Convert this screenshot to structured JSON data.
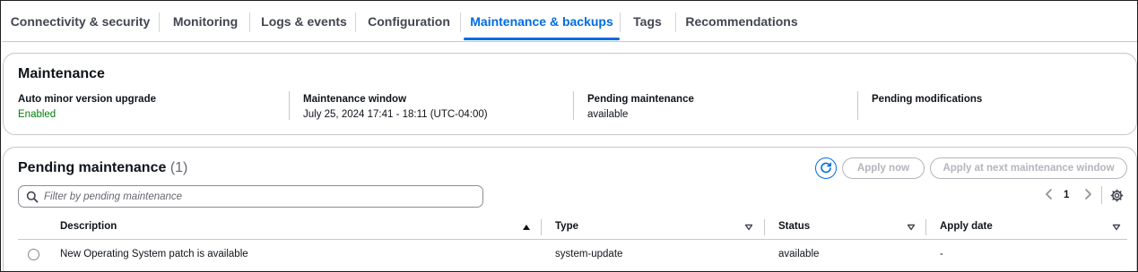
{
  "tabs": [
    {
      "label": "Connectivity & security"
    },
    {
      "label": "Monitoring"
    },
    {
      "label": "Logs & events"
    },
    {
      "label": "Configuration"
    },
    {
      "label": "Maintenance & backups"
    },
    {
      "label": "Tags"
    },
    {
      "label": "Recommendations"
    }
  ],
  "active_tab": "Maintenance & backups",
  "maintenance": {
    "title": "Maintenance",
    "auto_minor": {
      "label": "Auto minor version upgrade",
      "value": "Enabled"
    },
    "window": {
      "label": "Maintenance window",
      "value": "July 25, 2024 17:41 - 18:11 (UTC-04:00)"
    },
    "pending": {
      "label": "Pending maintenance",
      "value": "available"
    },
    "modifications": {
      "label": "Pending modifications",
      "value": ""
    }
  },
  "pending_maintenance": {
    "title": "Pending maintenance",
    "count": "(1)",
    "apply_now_label": "Apply now",
    "apply_next_label": "Apply at next maintenance window",
    "search_placeholder": "Filter by pending maintenance",
    "page": "1",
    "columns": {
      "description": "Description",
      "type": "Type",
      "status": "Status",
      "apply_date": "Apply date"
    },
    "rows": [
      {
        "description": "New Operating System patch is available",
        "type": "system-update",
        "status": "available",
        "apply_date": "-"
      }
    ]
  },
  "icons": {
    "refresh": "refresh-icon",
    "search": "search-icon",
    "settings": "gear-icon",
    "prev": "chevron-left-icon",
    "next": "chevron-right-icon"
  },
  "colors": {
    "accent": "#006ce0",
    "success": "#037f0c",
    "disabled": "#b4b4bb"
  }
}
